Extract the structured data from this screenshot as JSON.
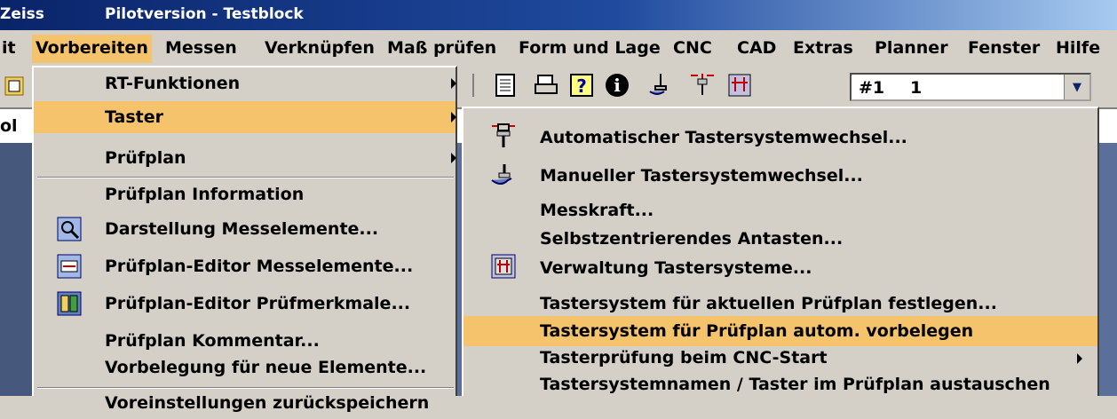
{
  "window": {
    "app_title": "Zeiss",
    "doc_title": "Pilotversion - Testblock"
  },
  "menubar": [
    {
      "label": "it"
    },
    {
      "label": "Vorbereiten",
      "active": true
    },
    {
      "label": "Messen"
    },
    {
      "label": "Verknüpfen"
    },
    {
      "label": "Maß prüfen"
    },
    {
      "label": "Form und Lage"
    },
    {
      "label": "CNC"
    },
    {
      "label": "CAD"
    },
    {
      "label": "Extras"
    },
    {
      "label": "Planner"
    },
    {
      "label": "Fenster"
    },
    {
      "label": "Hilfe"
    }
  ],
  "toolbar": {
    "combo_value_1": "#1",
    "combo_value_2": "1",
    "combo_arrow": "▼"
  },
  "field_row": {
    "text": "ol"
  },
  "vorbereiten_menu": {
    "items": [
      {
        "label": "RT-Funktionen",
        "submenu": true
      },
      {
        "label": "Taster",
        "submenu": true,
        "highlighted": true
      },
      {
        "label": "Prüfplan",
        "submenu": true
      },
      {
        "label": "Prüfplan Information"
      },
      {
        "label": "Darstellung Messelemente...",
        "icon": "display-elements-icon"
      },
      {
        "label": "Prüfplan-Editor Messelemente...",
        "icon": "plan-editor-elements-icon"
      },
      {
        "label": "Prüfplan-Editor Prüfmerkmale...",
        "icon": "plan-editor-features-icon"
      },
      {
        "label": "Prüfplan Kommentar..."
      },
      {
        "label": "Vorbelegung für neue Elemente..."
      },
      {
        "label": "Voreinstellungen zurückspeichern"
      }
    ]
  },
  "taster_submenu": {
    "items": [
      {
        "label": "Automatischer Tastersystemwechsel...",
        "icon": "auto-probe-change-icon"
      },
      {
        "label": "Manueller Tastersystemwechsel...",
        "icon": "manual-probe-change-icon"
      },
      {
        "label": "Messkraft..."
      },
      {
        "label": "Selbstzentrierendes Antasten..."
      },
      {
        "label": "Verwaltung Tastersysteme...",
        "icon": "probe-management-icon"
      },
      {
        "label": "Tastersystem für aktuellen Prüfplan festlegen..."
      },
      {
        "label": "Tastersystem für Prüfplan autom. vorbelegen",
        "highlighted": true
      },
      {
        "label": "Tasterprüfung beim CNC-Start",
        "submenu": true
      },
      {
        "label": "Tastersystemnamen / Taster im Prüfplan austauschen"
      }
    ]
  },
  "colors": {
    "highlight": "#f5c36b",
    "menu_bg": "#d4d0c8",
    "title_blue": "#0a246a"
  }
}
